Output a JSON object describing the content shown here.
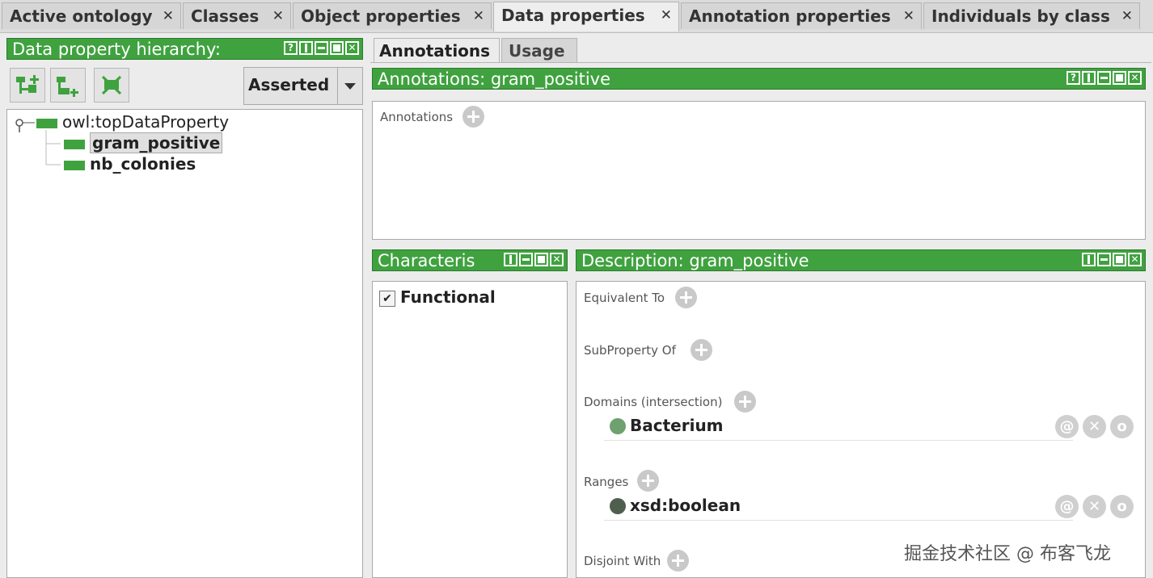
{
  "tabs": [
    {
      "label": "Active ontology"
    },
    {
      "label": "Classes"
    },
    {
      "label": "Object properties"
    },
    {
      "label": "Data properties"
    },
    {
      "label": "Annotation properties"
    },
    {
      "label": "Individuals by class"
    }
  ],
  "hierarchy": {
    "title": "Data property hierarchy:",
    "help_glyph": "?",
    "close_glyph": "✕",
    "mode": "Asserted",
    "root": "owl:topDataProperty",
    "children": [
      "gram_positive",
      "nb_colonies"
    ]
  },
  "right_tabs": [
    "Annotations",
    "Usage"
  ],
  "annotations": {
    "title": "Annotations: gram_positive",
    "section_label": "Annotations",
    "help_glyph": "?",
    "close_glyph": "✕"
  },
  "characteristics": {
    "title": "Characteris",
    "close_glyph": "✕",
    "functional_label": "Functional",
    "functional_checked": true,
    "check_glyph": "✔"
  },
  "description": {
    "title": "Description: gram_positive",
    "close_glyph": "✕",
    "equivalent_label": "Equivalent To",
    "subproperty_label": "SubProperty Of",
    "domains_label": "Domains (intersection)",
    "domain_item": "Bacterium",
    "ranges_label": "Ranges",
    "range_item": "xsd:boolean",
    "disjoint_label": "Disjoint With",
    "annotate_glyph": "@",
    "delete_glyph": "✕",
    "edit_glyph": "o"
  },
  "watermark": "掘金技术社区 @ 布客飞龙",
  "colors": {
    "accent_green": "#3fa23f",
    "class_dot": "#6fa06f",
    "datatype_dot": "#4f5f4f"
  }
}
